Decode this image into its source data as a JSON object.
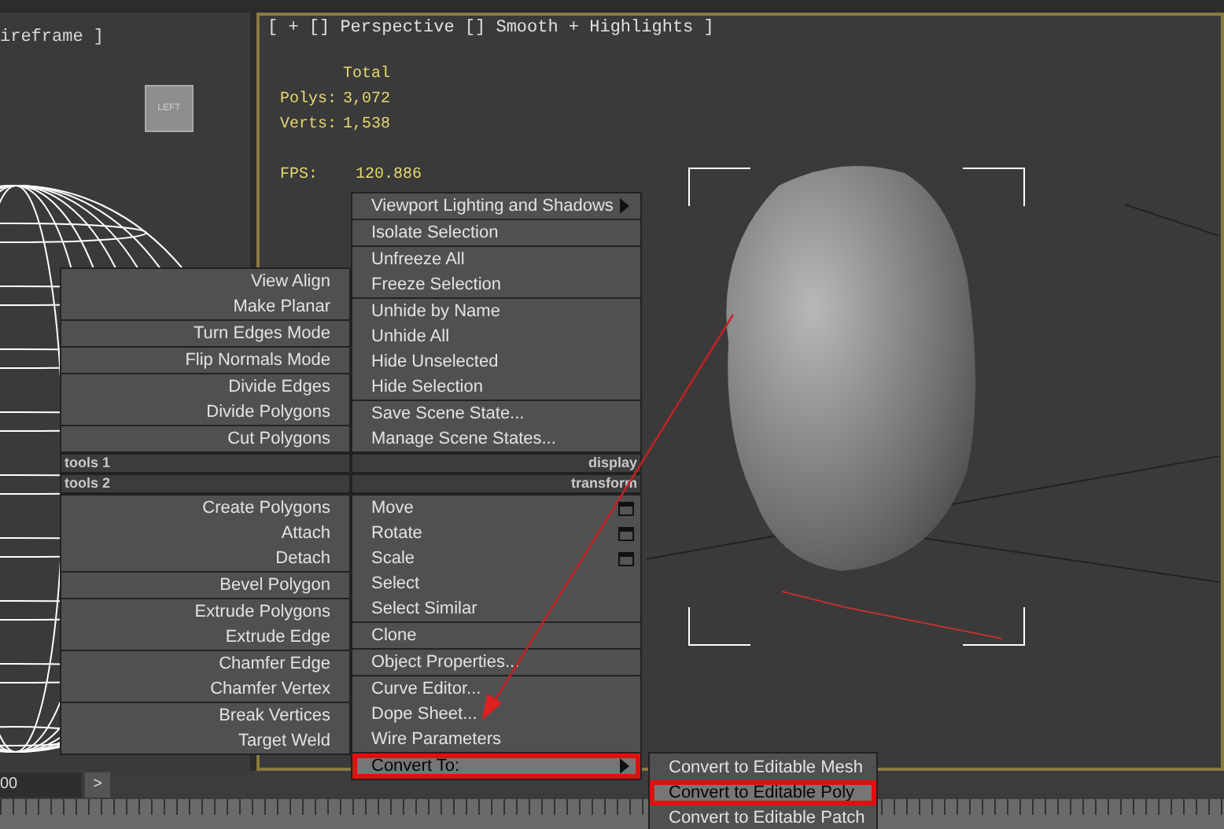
{
  "left_viewport": {
    "label": "ireframe ]",
    "viewcube": "LEFT"
  },
  "right_viewport": {
    "label": "[ + [] Perspective [] Smooth + Highlights ]",
    "stats": {
      "header": "Total",
      "rows": [
        {
          "label": "Polys:",
          "value": "3,072"
        },
        {
          "label": "Verts:",
          "value": "1,538"
        }
      ],
      "fps_label": "FPS:",
      "fps_value": "120.886"
    }
  },
  "quad_menu": {
    "top_left": {
      "title": "tools 1",
      "groups": [
        [
          {
            "label": "View Align"
          },
          {
            "label": "Make Planar"
          }
        ],
        [
          {
            "label": "Turn Edges Mode"
          }
        ],
        [
          {
            "label": "Flip Normals Mode"
          }
        ],
        [
          {
            "label": "Divide Edges"
          },
          {
            "label": "Divide Polygons"
          }
        ],
        [
          {
            "label": "Cut Polygons"
          }
        ]
      ]
    },
    "top_right": {
      "title": "display",
      "groups": [
        [
          {
            "label": "Viewport Lighting and Shadows",
            "submenu": true
          }
        ],
        [
          {
            "label": "Isolate Selection"
          }
        ],
        [
          {
            "label": "Unfreeze All"
          },
          {
            "label": "Freeze Selection"
          }
        ],
        [
          {
            "label": "Unhide by Name"
          },
          {
            "label": "Unhide All"
          },
          {
            "label": "Hide Unselected"
          },
          {
            "label": "Hide Selection"
          }
        ],
        [
          {
            "label": "Save Scene State..."
          },
          {
            "label": "Manage Scene States..."
          }
        ]
      ]
    },
    "bottom_left": {
      "title": "tools 2",
      "groups": [
        [
          {
            "label": "Create Polygons"
          },
          {
            "label": "Attach"
          },
          {
            "label": "Detach"
          }
        ],
        [
          {
            "label": "Bevel Polygon"
          }
        ],
        [
          {
            "label": "Extrude Polygons"
          },
          {
            "label": "Extrude Edge"
          }
        ],
        [
          {
            "label": "Chamfer Edge"
          },
          {
            "label": "Chamfer Vertex"
          }
        ],
        [
          {
            "label": "Break Vertices"
          },
          {
            "label": "Target Weld"
          }
        ]
      ]
    },
    "bottom_right": {
      "title": "transform",
      "groups": [
        [
          {
            "label": "Move",
            "settings": true
          },
          {
            "label": "Rotate",
            "settings": true
          },
          {
            "label": "Scale",
            "settings": true
          },
          {
            "label": "Select"
          },
          {
            "label": "Select Similar"
          }
        ],
        [
          {
            "label": "Clone"
          }
        ],
        [
          {
            "label": "Object Properties..."
          }
        ],
        [
          {
            "label": "Curve Editor..."
          },
          {
            "label": "Dope Sheet..."
          },
          {
            "label": "Wire Parameters"
          }
        ],
        [
          {
            "label": "Convert To:",
            "submenu": true,
            "selected": true,
            "annotated": true
          }
        ]
      ]
    }
  },
  "submenu": [
    {
      "label": "Convert to Editable Mesh",
      "selected": false,
      "annotated": false
    },
    {
      "label": "Convert to Editable Poly",
      "selected": true,
      "annotated": true
    },
    {
      "label": "Convert to Editable Patch",
      "selected": false,
      "annotated": false
    }
  ],
  "timeline": {
    "frame": "00",
    "next_button": ">"
  }
}
